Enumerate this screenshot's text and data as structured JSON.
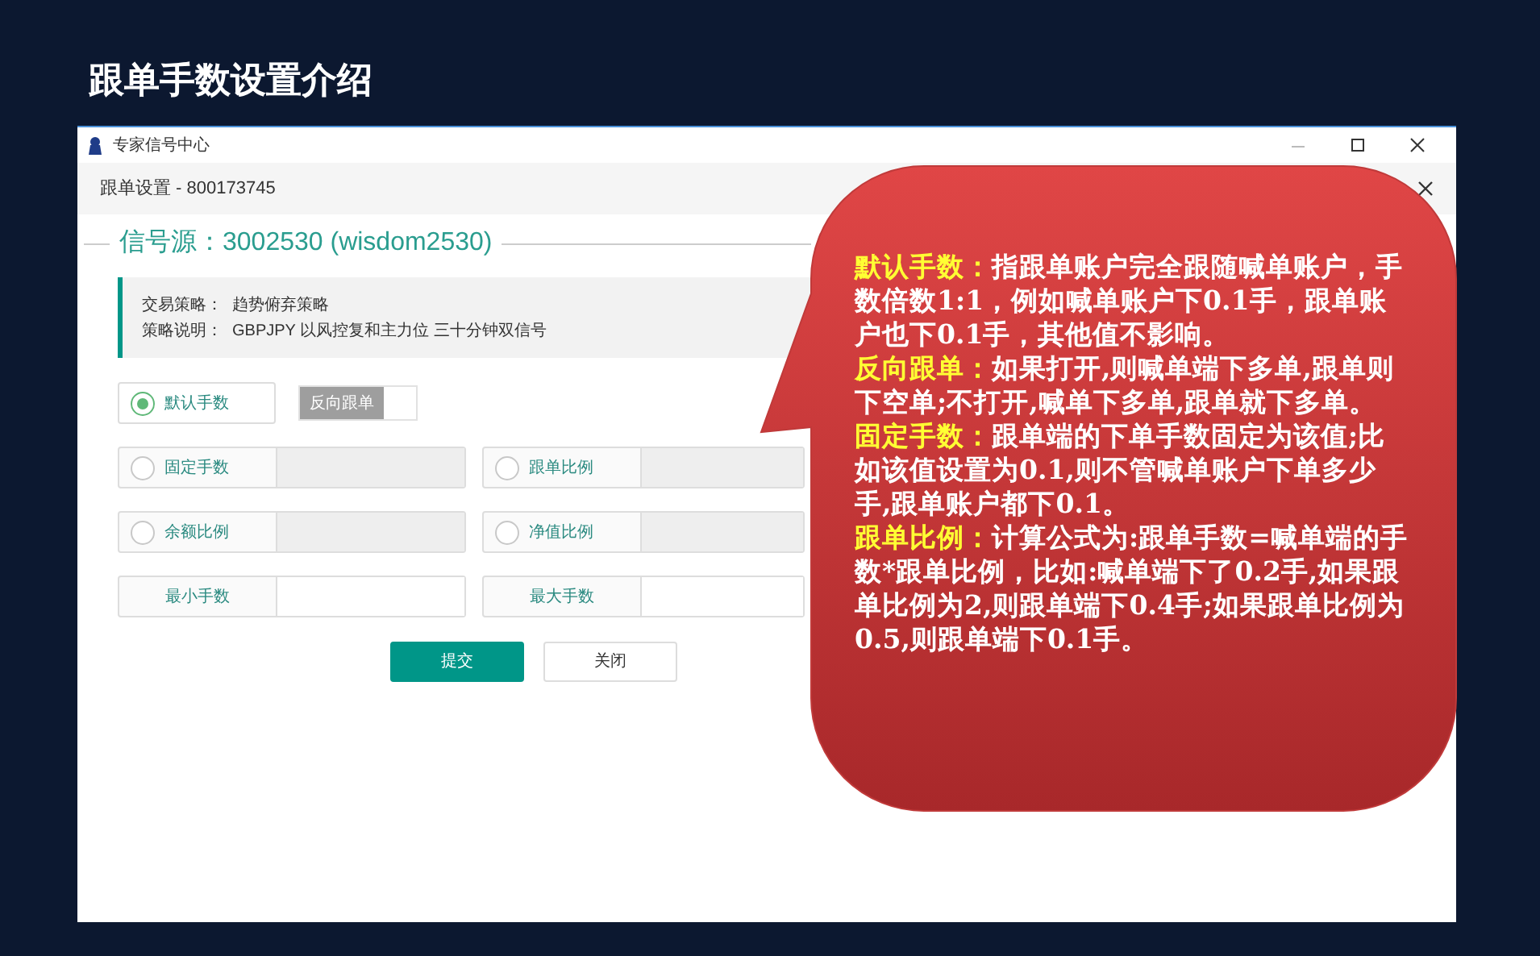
{
  "slide_title": "跟单手数设置介绍",
  "window": {
    "title": "专家信号中心"
  },
  "dialog": {
    "title": "跟单设置 - 800173745"
  },
  "signal_source": "信号源：3002530 (wisdom2530)",
  "strategy": [
    {
      "label": "交易策略：",
      "value": "趋势俯弃策略"
    },
    {
      "label": "策略说明：",
      "value": "GBPJPY 以风控复和主力位 三十分钟双信号"
    }
  ],
  "default_mode": {
    "label": "默认手数",
    "selected": true
  },
  "reverse_follow": {
    "label": "反向跟单",
    "on": false
  },
  "lot_modes": [
    {
      "label": "固定手数",
      "selected": false
    },
    {
      "label": "跟单比例",
      "selected": false
    },
    {
      "label": "余额比例",
      "selected": false
    },
    {
      "label": "净值比例",
      "selected": false
    }
  ],
  "limits": [
    {
      "label": "最小手数"
    },
    {
      "label": "最大手数"
    }
  ],
  "buttons": [
    {
      "label": "提交",
      "kind": "primary"
    },
    {
      "label": "关闭",
      "kind": "secondary"
    }
  ],
  "callout": [
    {
      "term": "默认手数：",
      "text": "指跟单账户完全跟随喊单账户，手数倍数1:1，例如喊单账户下0.1手，跟单账户也下0.1手，其他值不影响。"
    },
    {
      "term": "反向跟单：",
      "text": "如果打开,则喊单端下多单,跟单则下空单;不打开,喊单下多单,跟单就下多单。"
    },
    {
      "term": "固定手数：",
      "text": "跟单端的下单手数固定为该值;比如该值设置为0.1,则不管喊单账户下单多少手,跟单账户都下0.1。"
    },
    {
      "term": "跟单比例：",
      "text": "计算公式为:跟单手数=喊单端的手数*跟单比例，比如:喊单端下了0.2手,如果跟单比例为2,则跟单端下0.4手;如果跟单比例为0.5,则跟单端下0.1手。"
    }
  ]
}
